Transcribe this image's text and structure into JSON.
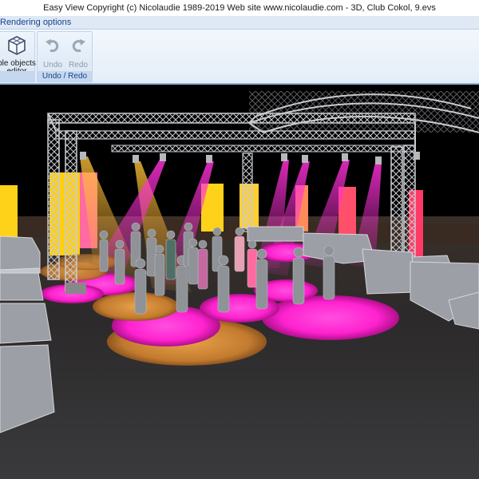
{
  "window": {
    "title": "Easy View   Copyright (c) Nicolaudie 1989-2019   Web site www.nicolaudie.com - 3D, Club Cokol, 9.evs"
  },
  "ribbon": {
    "active_tab": "Rendering options",
    "groups": [
      {
        "label": "",
        "buttons": [
          {
            "label_line1": "ble objects",
            "label_line2": "editor",
            "icon": "cube-objects-icon"
          }
        ]
      },
      {
        "label": "Undo / Redo",
        "buttons": [
          {
            "label": "Undo",
            "icon": "undo-icon",
            "enabled": false
          },
          {
            "label": "Redo",
            "icon": "redo-icon",
            "enabled": false
          }
        ]
      }
    ]
  },
  "scene": {
    "description_colors": {
      "background": "#000000",
      "floor": "#2b2b2d",
      "truss": "#c9cbd0",
      "magenta_light": "#ff2ad2",
      "orange_light": "#d9903a",
      "yellow_panel": "#ffd400",
      "pink_panel": "#ff5a8c"
    }
  }
}
